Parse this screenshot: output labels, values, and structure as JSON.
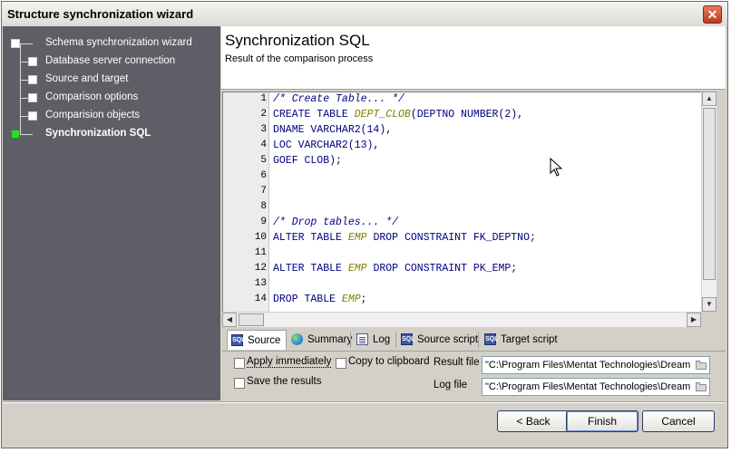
{
  "window": {
    "title": "Structure synchronization wizard",
    "close_glyph": "✕"
  },
  "nav": {
    "items": [
      {
        "label": "Schema synchronization wizard",
        "active": false
      },
      {
        "label": "Database server connection",
        "active": false
      },
      {
        "label": "Source and target",
        "active": false
      },
      {
        "label": "Comparison options",
        "active": false
      },
      {
        "label": "Comparision objects",
        "active": false
      },
      {
        "label": "Synchronization SQL",
        "active": true
      }
    ]
  },
  "header": {
    "title": "Synchronization SQL",
    "subtitle": "Result of the comparison process"
  },
  "editor": {
    "line_numbers": [
      "1",
      "2",
      "3",
      "4",
      "5",
      "6",
      "7",
      "8",
      "9",
      "10",
      "11",
      "12",
      "13",
      "14"
    ],
    "lines": [
      [
        {
          "t": "/* Create Table... */",
          "c": "cm"
        }
      ],
      [
        {
          "t": "CREATE TABLE ",
          "c": ""
        },
        {
          "t": "DEPT_CLOB",
          "c": "tn"
        },
        {
          "t": "(DEPTNO NUMBER(",
          "c": ""
        },
        {
          "t": "2",
          "c": "num"
        },
        {
          "t": "),",
          "c": ""
        }
      ],
      [
        {
          "t": "DNAME VARCHAR2(",
          "c": ""
        },
        {
          "t": "14",
          "c": "num"
        },
        {
          "t": "),",
          "c": ""
        }
      ],
      [
        {
          "t": "LOC VARCHAR2(",
          "c": ""
        },
        {
          "t": "13",
          "c": "num"
        },
        {
          "t": "),",
          "c": ""
        }
      ],
      [
        {
          "t": "GOEF CLOB);",
          "c": ""
        }
      ],
      [],
      [],
      [],
      [
        {
          "t": "/* Drop tables... */",
          "c": "cm"
        }
      ],
      [
        {
          "t": "ALTER TABLE ",
          "c": ""
        },
        {
          "t": "EMP",
          "c": "tn"
        },
        {
          "t": " DROP CONSTRAINT FK_DEPTNO;",
          "c": ""
        }
      ],
      [],
      [
        {
          "t": "ALTER TABLE ",
          "c": ""
        },
        {
          "t": "EMP",
          "c": "tn"
        },
        {
          "t": " DROP CONSTRAINT PK_EMP;",
          "c": ""
        }
      ],
      [],
      [
        {
          "t": "DROP TABLE ",
          "c": ""
        },
        {
          "t": "EMP",
          "c": "tn"
        },
        {
          "t": ";",
          "c": ""
        }
      ]
    ]
  },
  "tabs": [
    {
      "label": "Source",
      "icon": "sql-file-icon",
      "active": true
    },
    {
      "label": "Summary",
      "icon": "globe-icon",
      "active": false
    },
    {
      "label": "Log",
      "icon": "document-icon",
      "active": false
    },
    {
      "label": "Source script",
      "icon": "sql-file-icon",
      "active": false
    },
    {
      "label": "Target script",
      "icon": "sql-file-icon",
      "active": false
    }
  ],
  "options": {
    "apply_immediately": {
      "label": "Apply immediately",
      "checked": false
    },
    "copy_to_clipboard": {
      "label": "Copy to clipboard",
      "checked": false
    },
    "save_results": {
      "label": "Save the results",
      "checked": false
    }
  },
  "files": {
    "result_label": "Result file",
    "result_value": "\"C:\\Program Files\\Mentat Technologies\\Dream",
    "log_label": "Log file",
    "log_value": "\"C:\\Program Files\\Mentat Technologies\\Dream"
  },
  "buttons": {
    "back": "< Back",
    "finish": "Finish",
    "cancel": "Cancel"
  }
}
